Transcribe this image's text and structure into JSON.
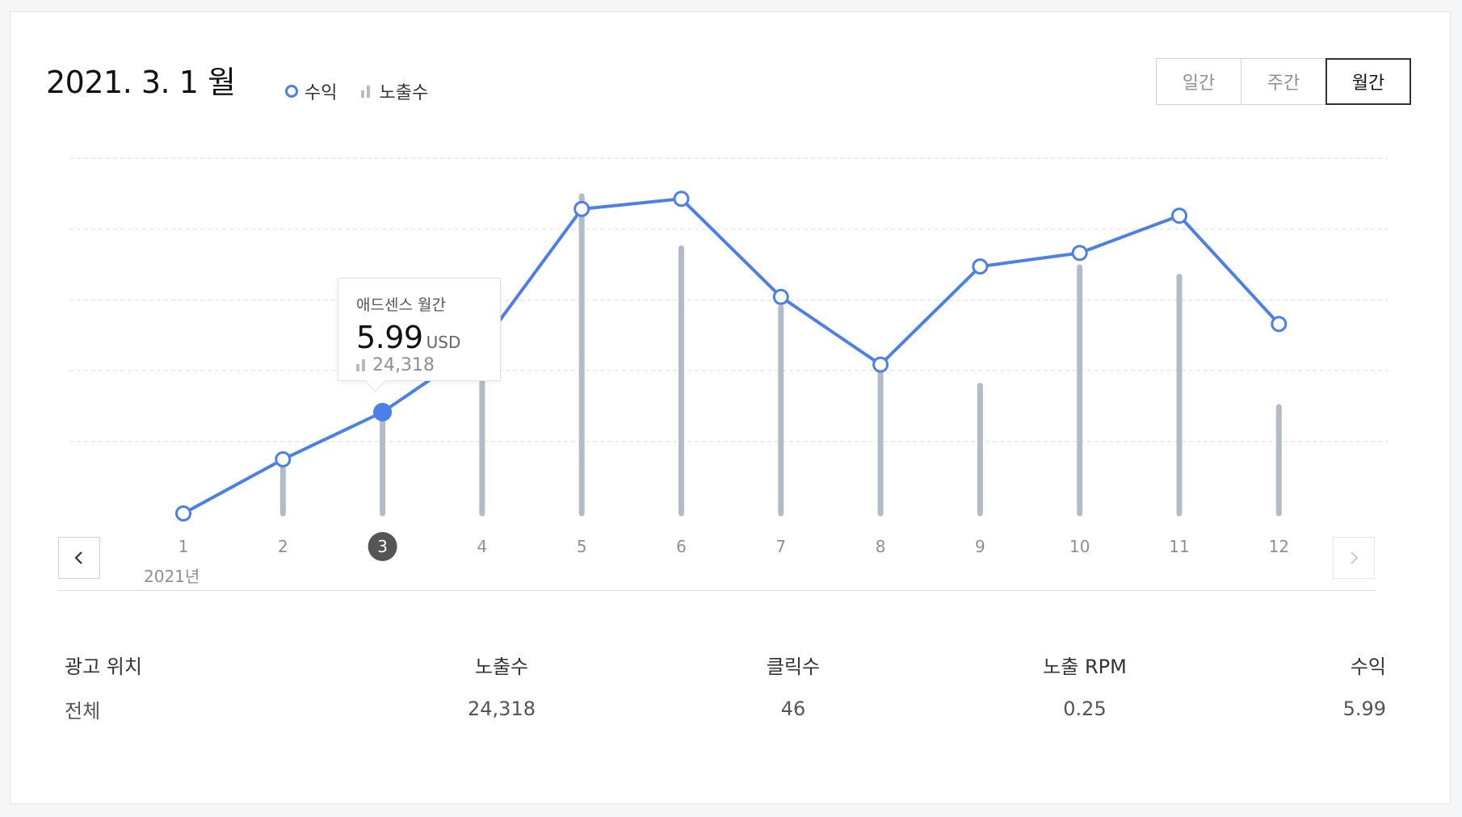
{
  "header": {
    "title": "2021. 3. 1 월",
    "legend_revenue": "수익",
    "legend_impressions": "노출수"
  },
  "periods": [
    {
      "label": "일간",
      "active": false
    },
    {
      "label": "주간",
      "active": false
    },
    {
      "label": "월간",
      "active": true
    }
  ],
  "tooltip": {
    "title": "애드센스 월간",
    "value": "5.99",
    "unit": "USD",
    "impressions": "24,318"
  },
  "year_label": "2021년",
  "colors": {
    "line": "#4a80e8",
    "bar": "#b3bcc6",
    "selected_badge": "#555555",
    "grid": "#dfe2e6"
  },
  "chart_data": {
    "type": "line",
    "categories": [
      "1",
      "2",
      "3",
      "4",
      "5",
      "6",
      "7",
      "8",
      "9",
      "10",
      "11",
      "12"
    ],
    "selected_index": 2,
    "series": [
      {
        "name": "수익",
        "kind": "line",
        "values": [
          0.0,
          3.2,
          5.99,
          10.0,
          18.0,
          18.6,
          12.8,
          8.8,
          14.6,
          15.4,
          17.6,
          11.2
        ]
      },
      {
        "name": "노출수",
        "kind": "bar",
        "values": [
          0,
          25000,
          43000,
          62000,
          134000,
          112000,
          87000,
          63000,
          54000,
          104000,
          100000,
          45000
        ]
      }
    ],
    "ylim_revenue": [
      0,
      21
    ],
    "ylim_impressions": [
      0,
      150000
    ],
    "grid": true
  },
  "table": {
    "headers": [
      "광고 위치",
      "노출수",
      "클릭수",
      "노출 RPM",
      "수익"
    ],
    "rows": [
      [
        "전체",
        "24,318",
        "46",
        "0.25",
        "5.99"
      ]
    ]
  }
}
